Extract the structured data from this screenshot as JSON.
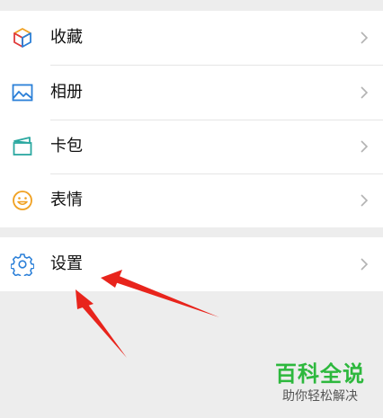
{
  "menu": {
    "items": [
      {
        "label": "收藏",
        "icon": "cube-icon"
      },
      {
        "label": "相册",
        "icon": "image-icon"
      },
      {
        "label": "卡包",
        "icon": "card-wallet-icon"
      },
      {
        "label": "表情",
        "icon": "smiley-icon"
      }
    ],
    "settings": {
      "label": "设置",
      "icon": "gear-icon"
    }
  },
  "watermark": {
    "title": "百科全说",
    "subtitle": "助你轻松解决"
  },
  "colors": {
    "background": "#ededed",
    "arrow": "#e8241c",
    "watermark_green": "#2db83d"
  }
}
